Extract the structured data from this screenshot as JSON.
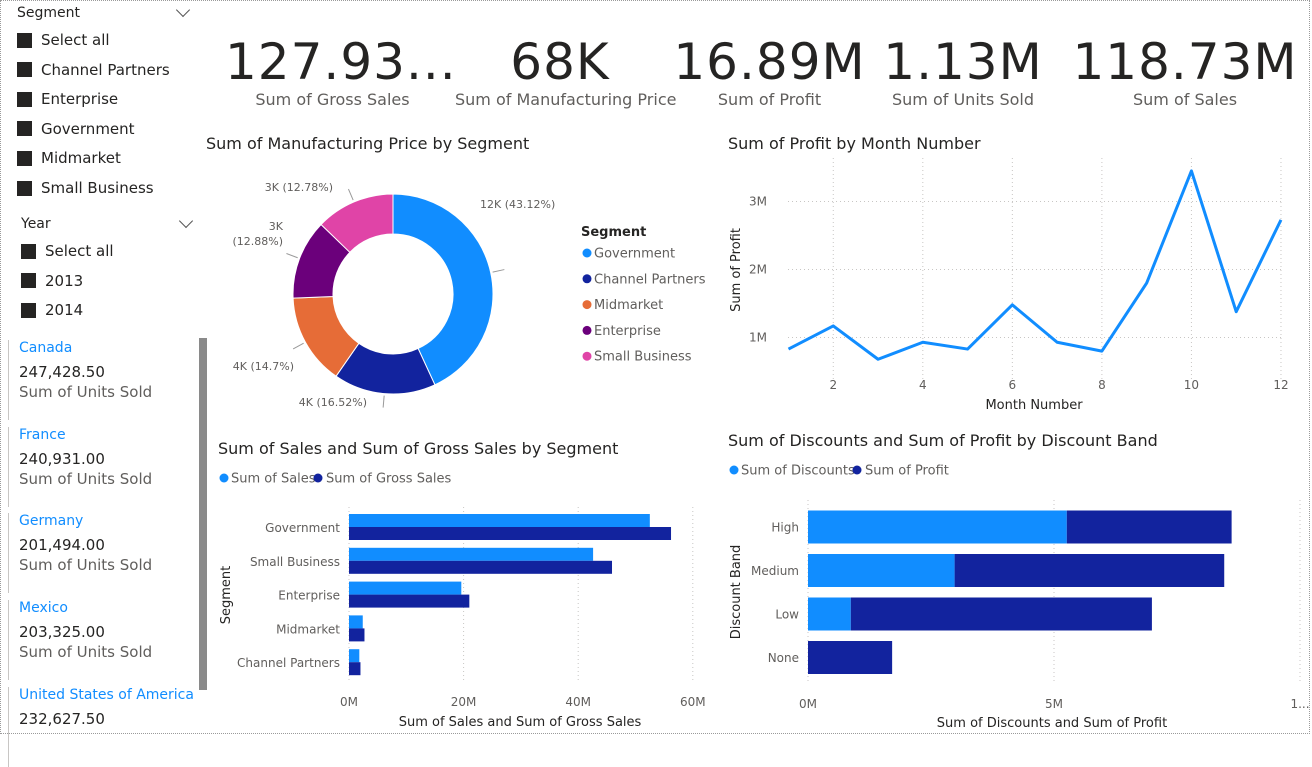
{
  "segment_slicer": {
    "title": "Segment",
    "options": [
      "Select all",
      "Channel Partners",
      "Enterprise",
      "Government",
      "Midmarket",
      "Small Business"
    ]
  },
  "year_slicer": {
    "title": "Year",
    "options": [
      "Select all",
      "2013",
      "2014"
    ]
  },
  "country_card": {
    "rows": [
      {
        "country": "Canada",
        "value": "247,428.50",
        "label": "Sum of Units Sold"
      },
      {
        "country": "France",
        "value": "240,931.00",
        "label": "Sum of Units Sold"
      },
      {
        "country": "Germany",
        "value": "201,494.00",
        "label": "Sum of Units Sold"
      },
      {
        "country": "Mexico",
        "value": "203,325.00",
        "label": "Sum of Units Sold"
      },
      {
        "country": "United States of America",
        "value": "232,627.50",
        "label": ""
      }
    ]
  },
  "kpis": [
    {
      "value": "127.93...",
      "label": "Sum of Gross Sales"
    },
    {
      "value": "68K",
      "label": "Sum of Manufacturing Price"
    },
    {
      "value": "16.89M",
      "label": "Sum of Profit"
    },
    {
      "value": "1.13M",
      "label": "Sum of Units Sold"
    },
    {
      "value": "118.73M",
      "label": "Sum of Sales"
    }
  ],
  "colors": {
    "light_blue": "#118dff",
    "dark_blue": "#12239e",
    "orange": "#e66c37",
    "purple": "#6b007b",
    "pink": "#e044a7",
    "line": "#118dff"
  },
  "chart_data": [
    {
      "type": "pie",
      "variant": "donut",
      "title": "Sum of Manufacturing Price by Segment",
      "legend_title": "Segment",
      "legend_position": "right",
      "categories": [
        "Government",
        "Channel Partners",
        "Midmarket",
        "Enterprise",
        "Small Business"
      ],
      "values": [
        43.12,
        16.52,
        14.7,
        12.88,
        12.78
      ],
      "data_labels": [
        "12K (43.12%)",
        "4K (16.52%)",
        "4K (14.7%)",
        "3K (12.88%)",
        "3K (12.78%)"
      ],
      "colors": [
        "#118dff",
        "#12239e",
        "#e66c37",
        "#6b007b",
        "#e044a7"
      ]
    },
    {
      "type": "line",
      "title": "Sum of Profit by Month Number",
      "xlabel": "Month Number",
      "ylabel": "Sum of Profit",
      "x": [
        1,
        2,
        3,
        4,
        5,
        6,
        7,
        8,
        9,
        10,
        11,
        12
      ],
      "y": [
        0.83,
        1.17,
        0.68,
        0.93,
        0.83,
        1.48,
        0.93,
        0.8,
        1.8,
        3.45,
        1.38,
        2.73
      ],
      "y_unit": "M",
      "xticks": [
        "2",
        "4",
        "6",
        "8",
        "10",
        "12"
      ],
      "yticks": [
        "1M",
        "2M",
        "3M"
      ],
      "ylim": [
        0.5,
        3.6
      ],
      "grid": true
    },
    {
      "type": "bar",
      "orientation": "horizontal",
      "title": "Sum of Sales and Sum of Gross Sales by Segment",
      "xlabel": "Sum of Sales and Sum of Gross Sales",
      "ylabel": "Segment",
      "legend_position": "top-left",
      "categories": [
        "Government",
        "Small Business",
        "Enterprise",
        "Midmarket",
        "Channel Partners"
      ],
      "series": [
        {
          "name": "Sum of Sales",
          "values": [
            52.5,
            42.6,
            19.6,
            2.4,
            1.8
          ]
        },
        {
          "name": "Sum of Gross Sales",
          "values": [
            56.2,
            45.9,
            21.0,
            2.7,
            2.0
          ]
        }
      ],
      "value_unit": "M",
      "xticks": [
        "0M",
        "20M",
        "40M",
        "60M"
      ],
      "xlim": [
        0,
        60
      ]
    },
    {
      "type": "bar",
      "orientation": "horizontal",
      "stacked": true,
      "title": "Sum of Discounts and Sum of Profit by Discount Band",
      "xlabel": "Sum of Discounts and Sum of Profit",
      "ylabel": "Discount Band",
      "legend_position": "top-left",
      "categories": [
        "High",
        "Medium",
        "Low",
        "None"
      ],
      "series": [
        {
          "name": "Sum of Discounts",
          "values": [
            5.26,
            2.98,
            0.87,
            0
          ]
        },
        {
          "name": "Sum of Profit",
          "values": [
            3.35,
            5.48,
            6.12,
            1.71
          ]
        }
      ],
      "value_unit": "M",
      "xticks": [
        "0M",
        "5M",
        "1..."
      ],
      "xlim": [
        0,
        9.8
      ]
    }
  ]
}
